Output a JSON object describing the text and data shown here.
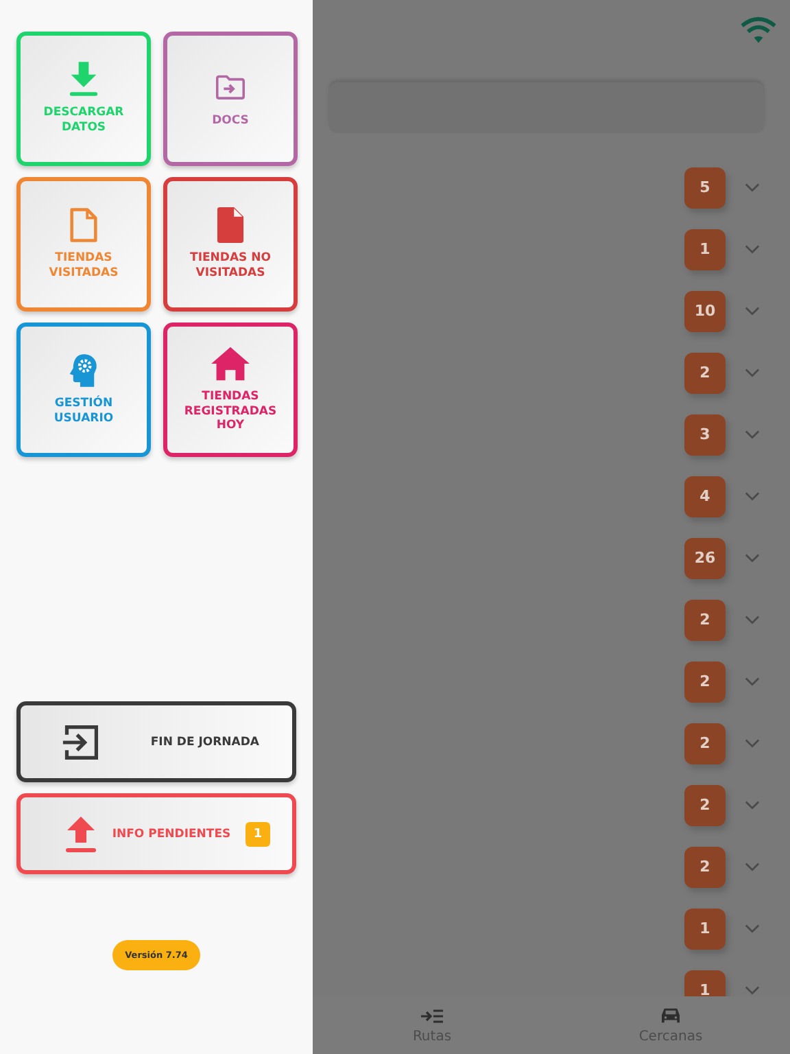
{
  "drawer": {
    "tiles": [
      {
        "label": "DESCARGAR DATOS",
        "color": "#1fd46c",
        "kind": "download"
      },
      {
        "label": "DOCS",
        "color": "#b368a6",
        "kind": "folder"
      },
      {
        "label": "TIENDAS VISITADAS",
        "color": "#ee8633",
        "kind": "outline"
      },
      {
        "label": "TIENDAS NO VISITADAS",
        "color": "#d63e3e",
        "kind": "file"
      },
      {
        "label": "GESTIÓN USUARIO",
        "color": "#1795d4",
        "kind": "user"
      },
      {
        "label": "TIENDAS REGISTRADAS HOY",
        "color": "#dc2466",
        "kind": "home"
      }
    ],
    "actions": [
      {
        "label": "FIN DE JORNADA",
        "color": "#3a3a3a",
        "kind": "exit"
      },
      {
        "label": "INFO PENDIENTES",
        "color": "#ef4a50",
        "kind": "upload",
        "badge": "1"
      }
    ],
    "version": "Versión 7.74"
  },
  "main": {
    "rows": [
      {
        "count": "5"
      },
      {
        "count": "1"
      },
      {
        "count": "10"
      },
      {
        "count": "2"
      },
      {
        "count": "3"
      },
      {
        "count": "4"
      },
      {
        "count": "26"
      },
      {
        "count": "2"
      },
      {
        "count": "2"
      },
      {
        "count": "2"
      },
      {
        "count": "2"
      },
      {
        "count": "2"
      },
      {
        "count": "1"
      },
      {
        "count": "1"
      }
    ],
    "nav": [
      {
        "label": "Rutas"
      },
      {
        "label": "Cercanas"
      }
    ]
  }
}
